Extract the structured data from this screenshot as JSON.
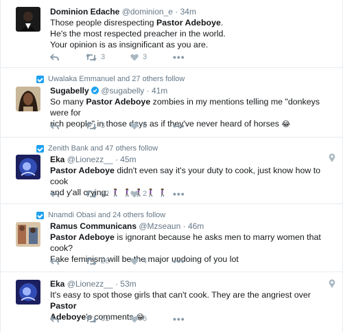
{
  "colors": {
    "accent": "#1da1f2",
    "muted": "#657786",
    "border": "#e6ecf0",
    "text": "#14171a"
  },
  "tweets": [
    {
      "name": "Dominion Edache",
      "handle": "@dominion_e",
      "time": "34m",
      "lines": [
        [
          "Those people disrespecting ",
          {
            "b": "Pastor Adeboye"
          },
          "."
        ],
        [
          "He's the most respected preacher in the world."
        ],
        [
          "Your opinion is as insignificant as you are."
        ]
      ],
      "retweets": "3",
      "likes": "3"
    },
    {
      "context": "Uwalaka Emmanuel and 27 others follow",
      "name": "Sugabelly",
      "verified": true,
      "handle": "@sugabelly",
      "time": "41m",
      "lines": [
        [
          "So many ",
          {
            "b": "Pastor Adeboye"
          },
          " zombies in my mentions telling me \"donkeys were for"
        ],
        [
          "rich people\" in those days as if they've never heard of horses ",
          {
            "e": "😂"
          }
        ]
      ],
      "retweets": "3",
      "likes": "5"
    },
    {
      "context": "Zenith Bank and 47 others follow",
      "name": "Eka",
      "handle": "@Lionezz__",
      "time": "45m",
      "location_pin": true,
      "lines": [
        [
          {
            "b": "Pastor Adeboye"
          },
          " didn't even say it's your duty to cook, just know how to cook"
        ],
        [
          "and y'all crying. ",
          {
            "e": "🚶🏾‍♀️ 🚶🏾‍♀️ 🚶🏾‍♀️ 🚶🏾‍♀️ 🚶🏾‍♀️"
          }
        ]
      ],
      "retweets": "32",
      "likes": "2"
    },
    {
      "context": "Nnamdi Obasi and 24 others follow",
      "name": "Ramus Communicans",
      "handle": "@Mzseaun",
      "time": "46m",
      "lines": [
        [
          {
            "b": "Pastor Adeboye"
          },
          " is ignorant because he asks men to marry women that cook?"
        ],
        [
          "Fake feminism will be the major undoing of you lot"
        ]
      ],
      "retweets": "26",
      "likes": "4"
    },
    {
      "name": "Eka",
      "handle": "@Lionezz__",
      "time": "53m",
      "location_pin": true,
      "lines": [
        [
          "It's easy to spot those girls that can't cook. They are the angriest over ",
          {
            "b": "Pastor"
          }
        ],
        [
          {
            "b": "Adeboye"
          },
          "'s comments ",
          {
            "e": "😂"
          }
        ]
      ],
      "retweets": "51",
      "likes": "6"
    }
  ],
  "icons": {
    "reply": "reply-icon",
    "retweet": "retweet-icon",
    "like": "heart-icon",
    "more": "more-icon",
    "follow": "follow-context-icon",
    "pin": "location-pin-icon"
  }
}
